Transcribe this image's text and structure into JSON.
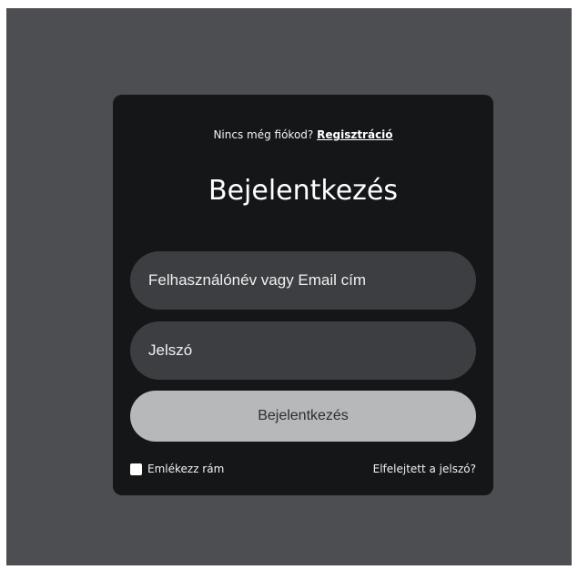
{
  "signup": {
    "prompt": "Nincs még fiókod?",
    "link_label": "Regisztráció"
  },
  "login": {
    "title": "Bejelentkezés",
    "username_placeholder": "Felhasználónév vagy Email cím",
    "password_placeholder": "Jelszó",
    "submit_label": "Bejelentkezés",
    "remember_label": "Emlékezz rám",
    "remember_checked": false,
    "forgot_label": "Elfelejtett a jelszó?"
  },
  "colors": {
    "page_background": "#4d4e52",
    "card_background": "#141618",
    "input_background": "#3c3e42",
    "button_background": "#b6b8ba"
  }
}
